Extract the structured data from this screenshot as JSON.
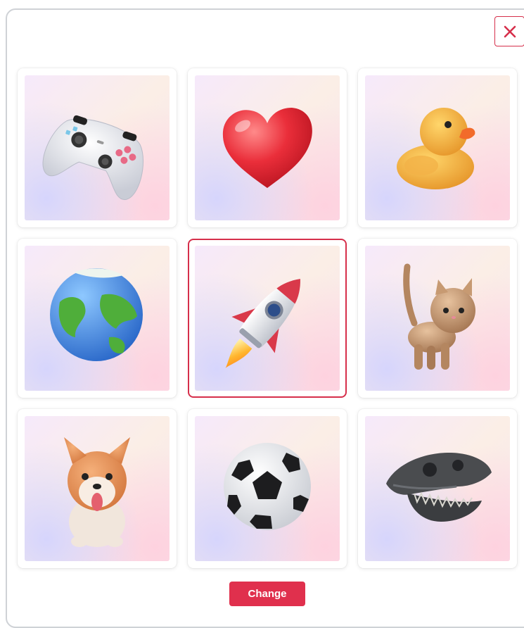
{
  "dialog": {
    "close_icon": "close-icon",
    "change_label": "Change",
    "accent_color": "#e0304d",
    "selected_index": 4
  },
  "options": [
    {
      "name": "game-controller",
      "icon": "game-controller-icon",
      "selected": false
    },
    {
      "name": "heart",
      "icon": "heart-icon",
      "selected": false
    },
    {
      "name": "rubber-duck",
      "icon": "rubber-duck-icon",
      "selected": false
    },
    {
      "name": "earth-globe",
      "icon": "earth-globe-icon",
      "selected": false
    },
    {
      "name": "rocket",
      "icon": "rocket-icon",
      "selected": true
    },
    {
      "name": "cat",
      "icon": "cat-icon",
      "selected": false
    },
    {
      "name": "corgi-dog",
      "icon": "corgi-dog-icon",
      "selected": false
    },
    {
      "name": "soccer-ball",
      "icon": "soccer-ball-icon",
      "selected": false
    },
    {
      "name": "dinosaur-skull",
      "icon": "dinosaur-skull-icon",
      "selected": false
    }
  ]
}
